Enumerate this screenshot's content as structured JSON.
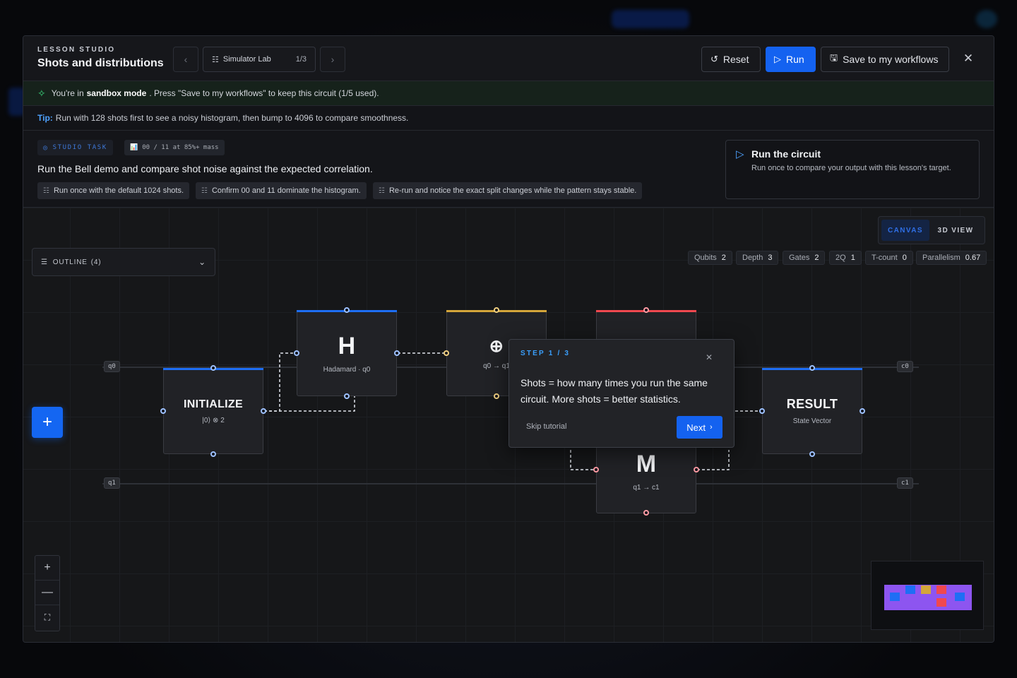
{
  "header": {
    "kicker": "LESSON STUDIO",
    "title": "Shots and distributions",
    "prev_icon": "‹",
    "next_icon": "›",
    "lab_icon": "☷",
    "lab_label": "Simulator Lab",
    "lab_count": "1/3",
    "reset_label": "Reset",
    "reset_icon": "↺",
    "run_label": "Run",
    "run_icon": "▷",
    "save_label": "Save to my workflows",
    "save_icon": "🖫",
    "close_icon": "✕"
  },
  "sandbox": {
    "icon": "✧",
    "prefix": "You're in",
    "mode": "sandbox mode",
    "suffix": ". Press \"Save to my workflows\" to keep this circuit (1/5 used)."
  },
  "tip": {
    "label": "Tip:",
    "text": "Run with 128 shots first to see a noisy histogram, then bump to 4096 to compare smoothness."
  },
  "task": {
    "chip_label": "STUDIO TASK",
    "chip_icon": "◎",
    "metric_icon": "📊",
    "metric_label": "00 / 11 at 85%+ mass",
    "question": "Run the Bell demo and compare shot noise against the expected correlation.",
    "sub_icon": "☷",
    "subtasks": [
      "Run once with the default 1024 shots.",
      "Confirm 00 and 11 dominate the histogram.",
      "Re-run and notice the exact split changes while the pattern stays stable."
    ],
    "run_card": {
      "icon": "▷",
      "title": "Run the circuit",
      "desc": "Run once to compare your output with this lesson's target."
    }
  },
  "canvas": {
    "view_canvas": "CANVAS",
    "view_3d": "3D VIEW",
    "stats": [
      {
        "label": "Qubits",
        "value": "2"
      },
      {
        "label": "Depth",
        "value": "3"
      },
      {
        "label": "Gates",
        "value": "2"
      },
      {
        "label": "2Q",
        "value": "1"
      },
      {
        "label": "T-count",
        "value": "0"
      },
      {
        "label": "Parallelism",
        "value": "0.67"
      }
    ],
    "outline_icon": "☰",
    "outline_label": "OUTLINE",
    "outline_count": "(4)",
    "outline_chev": "⌄",
    "wires": {
      "q0": "q0",
      "q1": "q1",
      "c0": "c0",
      "c1": "c1"
    },
    "nodes": {
      "init": {
        "title": "INITIALIZE",
        "sub": "|0⟩ ⊗ 2"
      },
      "h": {
        "title": "H",
        "sub": "Hadamard · q0"
      },
      "cx": {
        "title": "⊕",
        "sub": "q0 → q1"
      },
      "m": {
        "title": "M",
        "sub": "q1 → c1"
      },
      "result": {
        "title": "RESULT",
        "sub": "State Vector"
      }
    },
    "fab_icon": "+",
    "zoom_in": "+",
    "zoom_out": "—",
    "fit": "⛶"
  },
  "tutorial": {
    "step": "STEP 1 / 3",
    "close_icon": "✕",
    "text": "Shots = how many times you run the same circuit. More shots = better statistics.",
    "skip": "Skip tutorial",
    "next": "Next",
    "next_icon": "›"
  },
  "colors": {
    "accent": "#1462f0",
    "init_bar": "#1e6ef5",
    "h_bar": "#1e6ef5",
    "cx_bar": "#d4a63a",
    "m_bar": "#f0484f",
    "result_bar": "#1e6ef5"
  }
}
